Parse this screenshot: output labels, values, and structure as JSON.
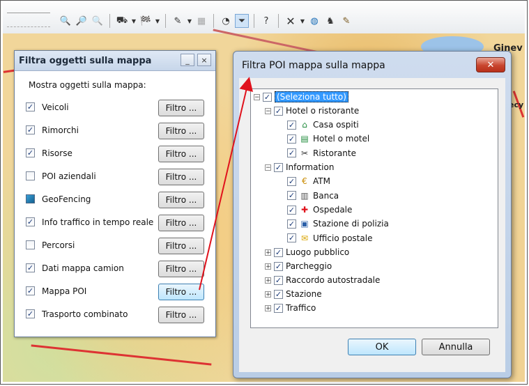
{
  "map": {
    "labels": [
      "Ginev",
      "ecy"
    ]
  },
  "toolbar": {
    "icons": [
      "zoom-in-icon",
      "zoom-area-icon",
      "zoom-out-icon",
      "vehicle-tool-icon",
      "flag-icon",
      "edit-route-icon",
      "layers-icon",
      "speedometer-icon",
      "filter-icon",
      "help-icon",
      "close-icon",
      "globe-icon",
      "user-icon",
      "pin-icon"
    ]
  },
  "filter_dialog": {
    "title": "Filtra oggetti sulla mappa",
    "minimize_label": "_",
    "close_label": "×",
    "intro": "Mostra oggetti sulla mappa:",
    "button_label": "Filtro ...",
    "items": [
      {
        "label": "Veicoli",
        "checked": true
      },
      {
        "label": "Rimorchi",
        "checked": true
      },
      {
        "label": "Risorse",
        "checked": true
      },
      {
        "label": "POI aziendali",
        "checked": false
      },
      {
        "label": "GeoFencing",
        "checked": "indeterminate"
      },
      {
        "label": "Info traffico in tempo reale",
        "checked": true
      },
      {
        "label": "Percorsi",
        "checked": false
      },
      {
        "label": "Dati mappa camion",
        "checked": true
      },
      {
        "label": "Mappa POI",
        "checked": true
      },
      {
        "label": "Trasporto combinato",
        "checked": true
      }
    ]
  },
  "poi_dialog": {
    "title": "Filtra POI mappa sulla mappa",
    "close_label": "✕",
    "ok_label": "OK",
    "cancel_label": "Annulla",
    "tree": {
      "root": "(Seleziona tutto)",
      "groups": [
        {
          "label": "Hotel o ristorante",
          "expanded": true,
          "children": [
            {
              "label": "Casa ospiti",
              "icon": "house-icon"
            },
            {
              "label": "Hotel o motel",
              "icon": "bed-icon"
            },
            {
              "label": "Ristorante",
              "icon": "cutlery-icon"
            }
          ]
        },
        {
          "label": "Information",
          "expanded": true,
          "children": [
            {
              "label": "ATM",
              "icon": "euro-coin-icon"
            },
            {
              "label": "Banca",
              "icon": "bank-icon"
            },
            {
              "label": "Ospedale",
              "icon": "red-cross-icon"
            },
            {
              "label": "Stazione di polizia",
              "icon": "police-icon"
            },
            {
              "label": "Ufficio postale",
              "icon": "envelope-icon"
            }
          ]
        },
        {
          "label": "Luogo pubblico",
          "expanded": false,
          "children": []
        },
        {
          "label": "Parcheggio",
          "expanded": false,
          "children": []
        },
        {
          "label": "Raccordo autostradale",
          "expanded": false,
          "children": []
        },
        {
          "label": "Stazione",
          "expanded": false,
          "children": []
        },
        {
          "label": "Traffico",
          "expanded": false,
          "children": []
        }
      ]
    }
  },
  "colors": {
    "arrow": "#e0121c",
    "map_base": "#f1d69a",
    "selection": "#3399ff"
  }
}
